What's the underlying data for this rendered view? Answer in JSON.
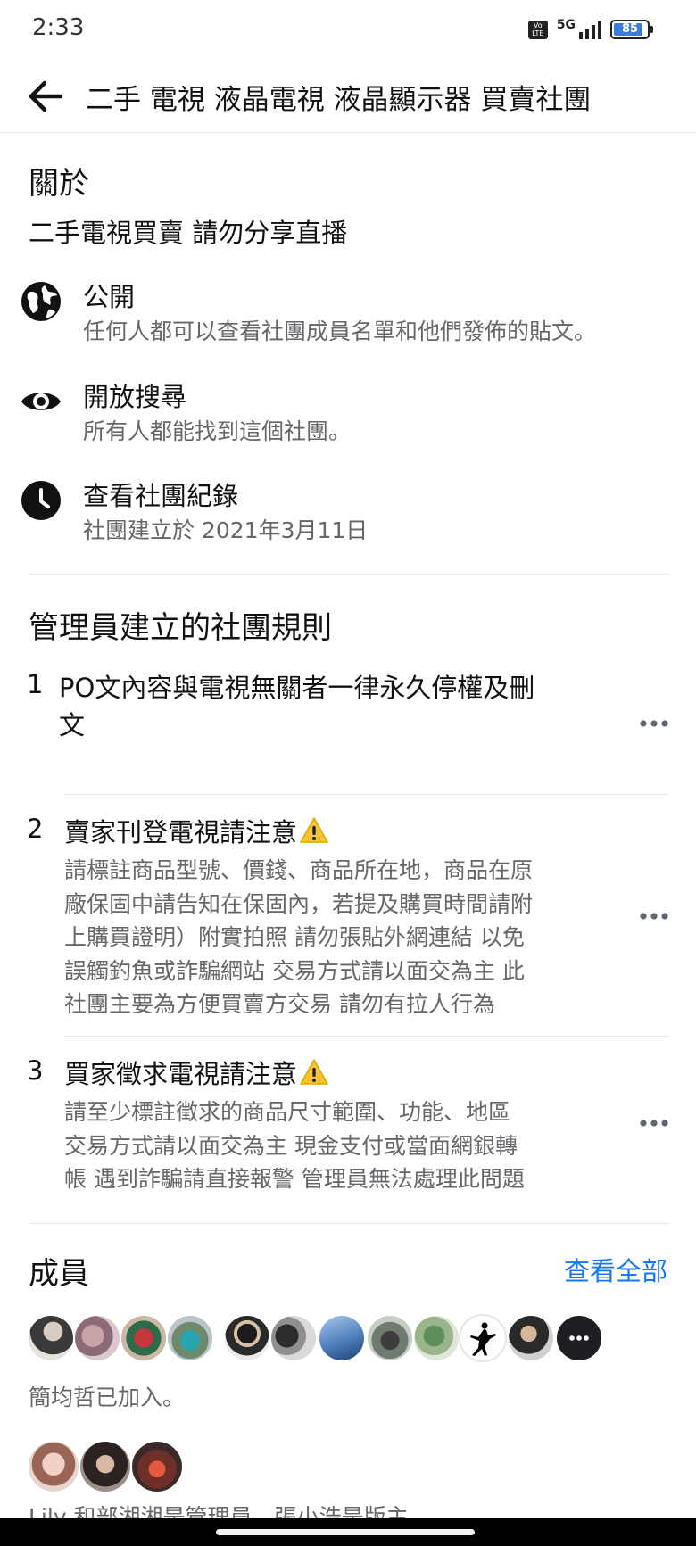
{
  "status_bar": {
    "time": "2:33",
    "volte": "Vo LTE",
    "network": "5G",
    "battery": "85"
  },
  "header": {
    "title": "二手 電視 液晶電視 液晶顯示器 買賣社團"
  },
  "about": {
    "heading": "關於",
    "description": "二手電視買賣 請勿分享直播",
    "items": [
      {
        "icon": "globe-icon",
        "label": "公開",
        "sub": "任何人都可以查看社團成員名單和他們發佈的貼文。"
      },
      {
        "icon": "eye-icon",
        "label": "開放搜尋",
        "sub": "所有人都能找到這個社團。"
      },
      {
        "icon": "clock-icon",
        "label": "查看社團紀錄",
        "sub": "社團建立於 2021年3月11日"
      }
    ]
  },
  "rules": {
    "heading": "管理員建立的社團規則",
    "items": [
      {
        "num": "1",
        "title_line1": "PO文內容與電視無關者一律永久停權及刪",
        "title_line2": "文",
        "body": []
      },
      {
        "num": "2",
        "title": "賣家刊登電視請注意",
        "body": [
          "請標註商品型號、價錢、商品所在地，商品在原",
          "廠保固中請告知在保固內，若提及購買時間請附",
          "上購買證明）附實拍照 請勿張貼外網連結 以免",
          "誤觸釣魚或詐騙網站 交易方式請以面交為主 此",
          "社團主要為方便買賣方交易 請勿有拉人行為"
        ]
      },
      {
        "num": "3",
        "title": "買家徵求電視請注意",
        "body": [
          "請至少標註徵求的商品尺寸範圍、功能、地區",
          "交易方式請以面交為主 現金支付或當面網銀轉",
          "帳 遇到詐騙請直接報警 管理員無法處理此問題"
        ]
      }
    ]
  },
  "members": {
    "heading": "成員",
    "see_all": "查看全部",
    "joined_text": "簡均哲已加入。",
    "partial_text": "Lily 和部湘湘是管理員。張小浩是版主"
  },
  "colors": {
    "link": "#1877f2",
    "secondary_text": "#65676b",
    "divider": "#e4e6eb",
    "warning": "#f7c234"
  }
}
